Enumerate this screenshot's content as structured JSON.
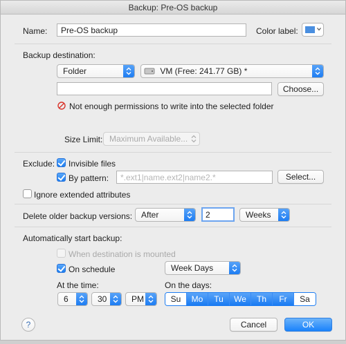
{
  "window": {
    "title": "Backup: Pre-OS backup"
  },
  "name_row": {
    "label": "Name:",
    "value": "Pre-OS backup",
    "color_label": "Color label:",
    "color_value": "#4a8fe0"
  },
  "destination": {
    "heading": "Backup destination:",
    "type_selected": "Folder",
    "volume_selected": "VM (Free: 241.77 GB) *",
    "path_value": "",
    "choose_label": "Choose...",
    "error_text": "Not enough permissions to write into the selected folder",
    "size_limit_label": "Size Limit:",
    "size_limit_selected": "Maximum Available..."
  },
  "exclude": {
    "label": "Exclude:",
    "invisible_label": "Invisible files",
    "invisible_checked": true,
    "pattern_label": "By pattern:",
    "pattern_checked": true,
    "pattern_placeholder": "*.ext1|name.ext2|name2.*",
    "select_label": "Select...",
    "ignore_label": "Ignore extended attributes",
    "ignore_checked": false
  },
  "delete_older": {
    "label": "Delete older backup versions:",
    "mode_selected": "After",
    "count_value": "2",
    "unit_selected": "Weeks"
  },
  "auto_start": {
    "heading": "Automatically start backup:",
    "when_mounted_label": "When destination is mounted",
    "when_mounted_checked": false,
    "on_schedule_label": "On schedule",
    "on_schedule_checked": true,
    "schedule_selected": "Week Days",
    "at_time_label": "At the time:",
    "hour": "6",
    "minute": "30",
    "ampm": "PM",
    "on_days_label": "On the days:",
    "days": [
      {
        "label": "Su",
        "selected": false
      },
      {
        "label": "Mo",
        "selected": true
      },
      {
        "label": "Tu",
        "selected": true
      },
      {
        "label": "We",
        "selected": true
      },
      {
        "label": "Th",
        "selected": true
      },
      {
        "label": "Fr",
        "selected": true
      },
      {
        "label": "Sa",
        "selected": false
      }
    ]
  },
  "footer": {
    "help_label": "?",
    "cancel_label": "Cancel",
    "ok_label": "OK"
  },
  "icons": {
    "error": "no-entry-icon",
    "stepper": "up-down-chevron-icon",
    "help": "question-mark-icon"
  },
  "colors": {
    "accent": "#1a7bf2",
    "error": "#d9342b"
  }
}
